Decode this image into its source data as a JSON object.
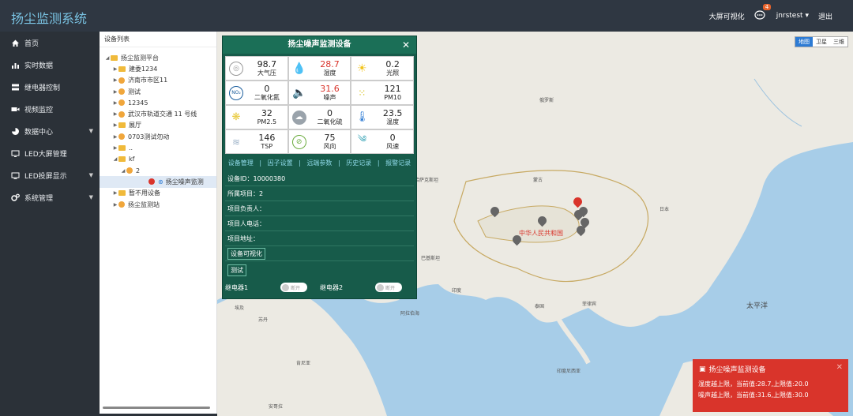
{
  "app": {
    "title": "扬尘监测系统"
  },
  "topbar": {
    "bigscreen_label": "大屏可视化",
    "notification_count": "4",
    "username": "jnrstest",
    "logout_label": "退出"
  },
  "sidebar": {
    "items": [
      {
        "label": "首页",
        "icon": "home-icon"
      },
      {
        "label": "实时数据",
        "icon": "bar-chart-icon"
      },
      {
        "label": "继电器控制",
        "icon": "server-icon"
      },
      {
        "label": "视频监控",
        "icon": "video-icon"
      },
      {
        "label": "数据中心",
        "icon": "pie-chart-icon",
        "has_submenu": true
      },
      {
        "label": "LED大屏管理",
        "icon": "monitor-icon"
      },
      {
        "label": "LED投屏显示",
        "icon": "display-icon",
        "has_submenu": true
      },
      {
        "label": "系统管理",
        "icon": "gears-icon",
        "has_submenu": true
      }
    ]
  },
  "tree": {
    "title": "设备列表",
    "nodes": [
      {
        "label": "扬尘监测平台",
        "type": "folder",
        "indent": 0,
        "expanded": true
      },
      {
        "label": "建委1234",
        "type": "folder",
        "indent": 1
      },
      {
        "label": "济南市市区11",
        "type": "group",
        "indent": 1
      },
      {
        "label": "测试",
        "type": "group",
        "indent": 1
      },
      {
        "label": "12345",
        "type": "group",
        "indent": 1
      },
      {
        "label": "武汉市轨道交通 11 号线",
        "type": "group",
        "indent": 1
      },
      {
        "label": "展厅",
        "type": "folder",
        "indent": 1
      },
      {
        "label": "0703测试勿动",
        "type": "group",
        "indent": 1
      },
      {
        "label": "..",
        "type": "folder",
        "indent": 1
      },
      {
        "label": "kf",
        "type": "folder",
        "indent": 1,
        "expanded": true
      },
      {
        "label": "2",
        "type": "group",
        "indent": 2,
        "expanded": true
      },
      {
        "label": "扬尘噪声监测",
        "type": "device",
        "indent": 3,
        "selected": true
      },
      {
        "label": "暂不用设备",
        "type": "folder",
        "indent": 1
      },
      {
        "label": "扬尘监测站",
        "type": "group",
        "indent": 1
      }
    ]
  },
  "popup": {
    "title": "扬尘噪声监测设备",
    "sensors": [
      {
        "value": "98.7",
        "label": "大气压",
        "icon": "pressure-icon",
        "alert": false
      },
      {
        "value": "28.7",
        "label": "湿度",
        "icon": "humidity-drop-icon",
        "alert": true
      },
      {
        "value": "0.2",
        "label": "光照",
        "icon": "sun-icon",
        "alert": false
      },
      {
        "value": "0",
        "label": "二氧化氮",
        "icon": "no2-icon",
        "alert": false
      },
      {
        "value": "31.6",
        "label": "噪声",
        "icon": "speaker-icon",
        "alert": true
      },
      {
        "value": "121",
        "label": "PM10",
        "icon": "pm10-dots-icon",
        "alert": false
      },
      {
        "value": "32",
        "label": "PM2.5",
        "icon": "pm25-dots-icon",
        "alert": false
      },
      {
        "value": "0",
        "label": "二氧化硫",
        "icon": "so2-cloud-icon",
        "alert": false
      },
      {
        "value": "23.5",
        "label": "温度",
        "icon": "thermometer-icon",
        "alert": false
      },
      {
        "value": "146",
        "label": "TSP",
        "icon": "tsp-icon",
        "alert": false
      },
      {
        "value": "75",
        "label": "风向",
        "icon": "compass-icon",
        "alert": false
      },
      {
        "value": "0",
        "label": "风速",
        "icon": "wind-icon",
        "alert": false
      }
    ],
    "tabs": [
      "设备管理",
      "因子设置",
      "远端参数",
      "历史记录",
      "报警记录"
    ],
    "device_id": "设备ID：10000380",
    "project": "所属项目：2",
    "manager": "项目负责人：",
    "phone": "项目人电话：",
    "address": "项目地址：",
    "visual_btn": "设备可视化",
    "test_btn": "测试",
    "relays": [
      {
        "label": "继电器1",
        "state": "断开"
      },
      {
        "label": "继电器2",
        "state": "断开"
      }
    ]
  },
  "map": {
    "buttons": [
      "地图",
      "卫星",
      "三维"
    ],
    "labels": [
      {
        "text": "中华人民共和国",
        "class": "country-label"
      },
      {
        "text": "太平洋",
        "class": "ocean-label"
      },
      {
        "text": "俄罗斯",
        "class": "label"
      },
      {
        "text": "蒙古",
        "class": "label"
      },
      {
        "text": "印度",
        "class": "label"
      },
      {
        "text": "哈萨克斯坦",
        "class": "label"
      },
      {
        "text": "日本",
        "class": "label"
      },
      {
        "text": "泰国",
        "class": "label"
      },
      {
        "text": "菲律宾",
        "class": "label"
      },
      {
        "text": "印度尼西亚",
        "class": "label"
      },
      {
        "text": "巴基斯坦",
        "class": "label"
      },
      {
        "text": "阿拉伯海",
        "class": "label"
      },
      {
        "text": "苏丹",
        "class": "label"
      },
      {
        "text": "埃及",
        "class": "label"
      },
      {
        "text": "肯尼亚",
        "class": "label"
      },
      {
        "text": "安哥拉",
        "class": "label"
      }
    ]
  },
  "alert": {
    "title": "扬尘噪声监测设备",
    "line1": "湿度越上限，当前值:28.7,上限值:20.0",
    "line2": "噪声越上限，当前值:31.6,上限值:30.0"
  },
  "colors": {
    "teal_header": "#1b6f57",
    "popup_bg": "#175b4a",
    "alert_red": "#d9342b",
    "title_blue": "#7ac4e4"
  }
}
